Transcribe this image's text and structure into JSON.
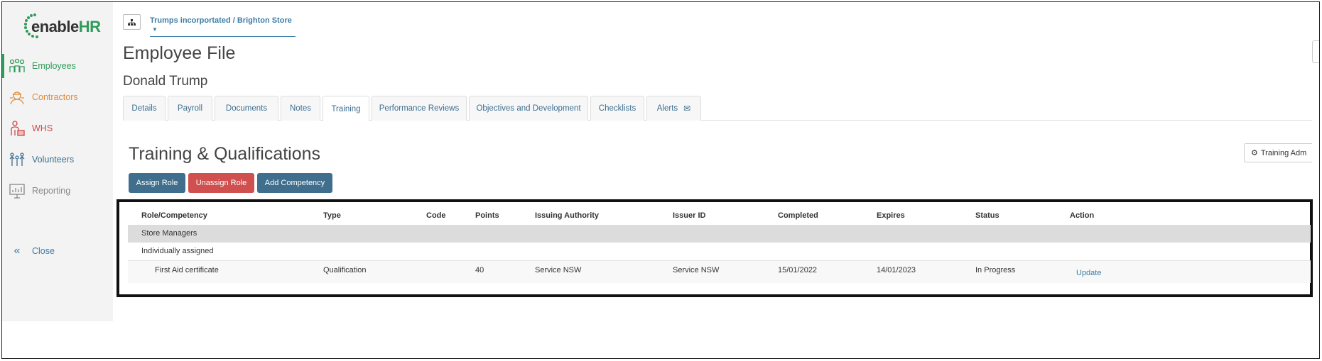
{
  "logo": {
    "brand_main": "enable",
    "brand_accent": "HR"
  },
  "sidebar": {
    "items": [
      {
        "label": "Employees",
        "color": "#2f9b5a",
        "icon": "employees-icon"
      },
      {
        "label": "Contractors",
        "color": "#e08a3c",
        "icon": "contractors-icon"
      },
      {
        "label": "WHS",
        "color": "#d04848",
        "icon": "whs-icon"
      },
      {
        "label": "Volunteers",
        "color": "#3d6f8f",
        "icon": "volunteers-icon"
      },
      {
        "label": "Reporting",
        "color": "#888888",
        "icon": "reporting-icon"
      }
    ],
    "close_label": "Close"
  },
  "header": {
    "org_selector": "Trumps incorportated / Brighton Store"
  },
  "page": {
    "title": "Employee File",
    "employee_name": "Donald Trump"
  },
  "tabs": [
    "Details",
    "Payroll",
    "Documents",
    "Notes",
    "Training",
    "Performance Reviews",
    "Objectives and Development",
    "Checklists",
    "Alerts"
  ],
  "active_tab": "Training",
  "section": {
    "title": "Training & Qualifications",
    "training_admin_label": "Training Adm",
    "buttons": {
      "assign_role": "Assign Role",
      "unassign_role": "Unassign Role",
      "add_competency": "Add Competency"
    }
  },
  "table": {
    "columns": [
      "Role/Competency",
      "Type",
      "Code",
      "Points",
      "Issuing Authority",
      "Issuer ID",
      "Completed",
      "Expires",
      "Status",
      "Action"
    ],
    "group": "Store Managers",
    "subgroup": "Individually assigned",
    "rows": [
      {
        "name": "First Aid certificate",
        "type": "Qualification",
        "code": "",
        "points": "40",
        "issuing_authority": "Service NSW",
        "issuer_id": "Service NSW",
        "completed": "15/01/2022",
        "expires": "14/01/2023",
        "status": "In Progress",
        "action": "Update"
      }
    ]
  },
  "colors": {
    "primary": "#3f6f8c",
    "danger": "#d05050",
    "brand_green": "#2f9b5a"
  }
}
